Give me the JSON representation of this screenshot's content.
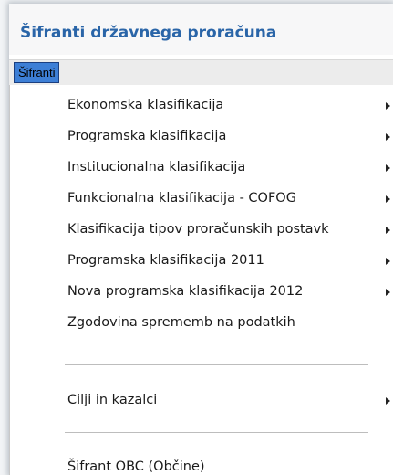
{
  "window": {
    "title": "Šifranti državnega proračuna"
  },
  "menubar": {
    "items": [
      {
        "label": "Šifranti",
        "active": true
      }
    ]
  },
  "dropdown": {
    "items": [
      {
        "label": "Ekonomska klasifikacija",
        "submenu": true
      },
      {
        "label": "Programska klasifikacija",
        "submenu": true
      },
      {
        "label": "Institucionalna klasifikacija",
        "submenu": true
      },
      {
        "label": "Funkcionalna klasifikacija - COFOG",
        "submenu": true
      },
      {
        "label": "Klasifikacija tipov proračunskih postavk",
        "submenu": true
      },
      {
        "label": "Programska klasifikacija 2011",
        "submenu": true
      },
      {
        "label": "Nova programska klasifikacija 2012",
        "submenu": true
      },
      {
        "label": "Zgodovina sprememb na podatkih",
        "submenu": false
      },
      {
        "label": "Cilji in kazalci",
        "submenu": true
      },
      {
        "label": "Šifrant OBC (Občine)",
        "submenu": false
      }
    ]
  },
  "colors": {
    "title": "#2a65a8",
    "menubar_active_bg": "#3d7fd6"
  }
}
